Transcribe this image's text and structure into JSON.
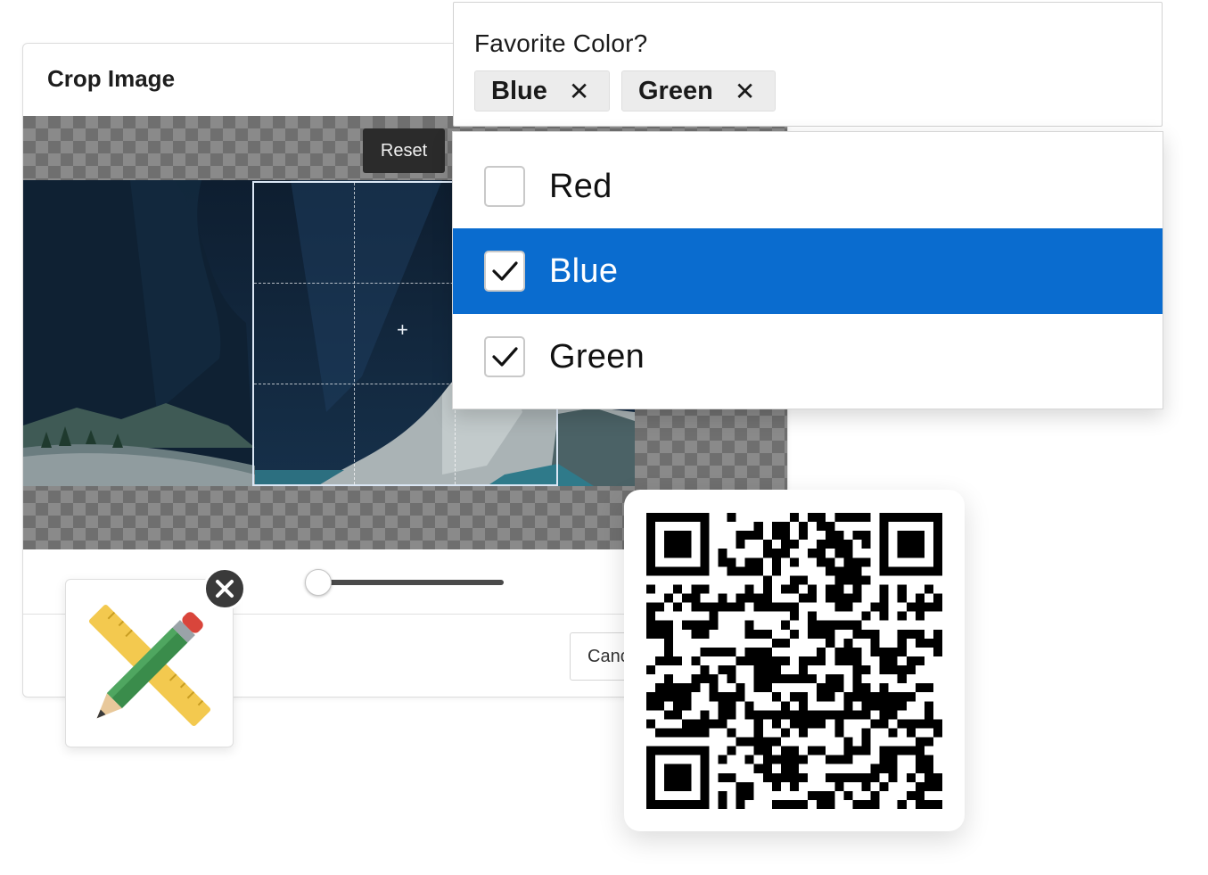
{
  "crop_dialog": {
    "title": "Crop Image",
    "reset_label": "Reset",
    "cancel_label": "Cancel",
    "zoom_level": 0
  },
  "favorite_color": {
    "label": "Favorite Color?",
    "chips": [
      {
        "label": "Blue",
        "remove_icon": "close-icon"
      },
      {
        "label": "Green",
        "remove_icon": "close-icon"
      }
    ],
    "chip_remove_glyph": "✕",
    "options": [
      {
        "label": "Red",
        "checked": false,
        "highlighted": false
      },
      {
        "label": "Blue",
        "checked": true,
        "highlighted": true
      },
      {
        "label": "Green",
        "checked": true,
        "highlighted": false
      }
    ],
    "highlight_color": "#0a6ccf"
  },
  "icons": {
    "tools": "pencil-ruler-icon",
    "badge": "close-icon",
    "qr": "qr-code-icon"
  }
}
